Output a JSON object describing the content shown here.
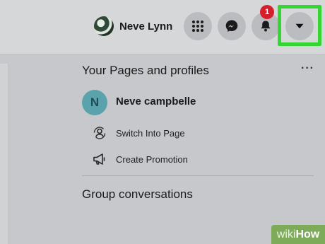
{
  "header": {
    "profile_name": "Neve Lynn",
    "buttons": [
      "menu-grid-icon",
      "messenger-icon",
      "bell-icon",
      "caret-down-icon"
    ],
    "notification_count": "1",
    "highlight_color": "#35d631"
  },
  "pages_section": {
    "title": "Your Pages and profiles",
    "more_label": "···",
    "page": {
      "initial": "N",
      "name": "Neve campbelle"
    },
    "actions": [
      {
        "label": "Switch Into Page",
        "icon": "switch-profile-icon"
      },
      {
        "label": "Create Promotion",
        "icon": "megaphone-icon"
      }
    ]
  },
  "group_section": {
    "title": "Group conversations"
  },
  "watermark": {
    "part1": "wiki",
    "part2": "How"
  }
}
